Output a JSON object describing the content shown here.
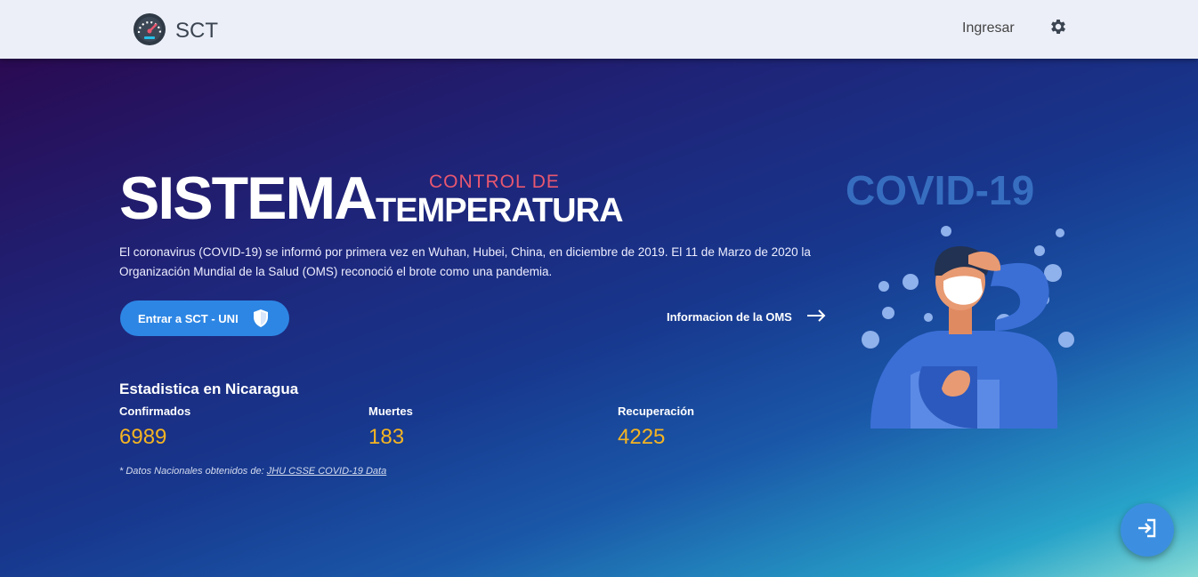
{
  "navbar": {
    "brand": "SCT",
    "login": "Ingresar"
  },
  "hero": {
    "title_big": "SISTEMA",
    "title_top": "CONTROL DE",
    "title_bottom": "TEMPERATURA",
    "description": "El coronavirus (COVID-19) se informó por primera vez en Wuhan, Hubei, China, en diciembre de 2019. El 11 de Marzo de 2020 la Organización Mundial de la Salud (OMS) reconoció el brote como una pandemia.",
    "enter_button": "Entrar a SCT - UNI",
    "who_link": "Informacion de la OMS",
    "illustration_text": "COVID-19"
  },
  "stats": {
    "title": "Estadistica en Nicaragua",
    "items": [
      {
        "label": "Confirmados",
        "value": "6989"
      },
      {
        "label": "Muertes",
        "value": "183"
      },
      {
        "label": "Recuperación",
        "value": "4225"
      }
    ],
    "source_prefix": "* Datos Nacionales obtenidos de:",
    "source_link": "JHU CSSE COVID-19 Data"
  },
  "colors": {
    "accent_red": "#e9576f",
    "stat_yellow": "#f5b422",
    "button_blue": "#2d86e4"
  }
}
